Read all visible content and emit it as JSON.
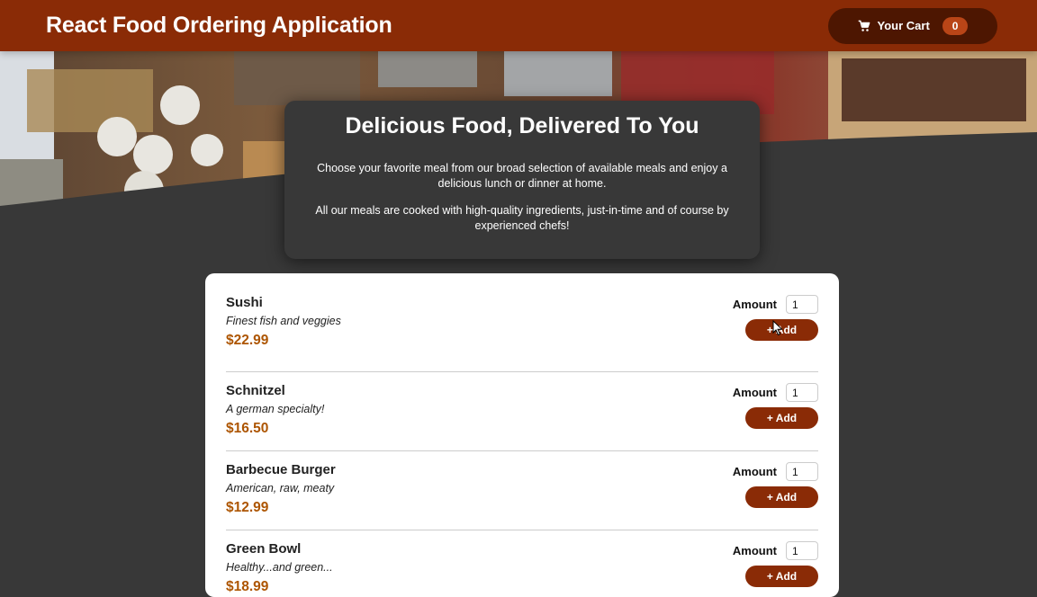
{
  "header": {
    "title": "React Food Ordering Application",
    "cart_label": "Your Cart",
    "cart_count": "0",
    "cart_icon": "cart-icon"
  },
  "summary": {
    "title": "Delicious Food, Delivered To You",
    "paragraph1": "Choose your favorite meal from our broad selection of available meals and enjoy a delicious lunch or dinner at home.",
    "paragraph2": "All our meals are cooked with high-quality ingredients, just-in-time and of course by experienced chefs!"
  },
  "meals": [
    {
      "name": "Sushi",
      "description": "Finest fish and veggies",
      "price": "$22.99",
      "amount_label": "Amount",
      "amount": "1",
      "add_label": "+ Add"
    },
    {
      "name": "Schnitzel",
      "description": "A german specialty!",
      "price": "$16.50",
      "amount_label": "Amount",
      "amount": "1",
      "add_label": "+ Add"
    },
    {
      "name": "Barbecue Burger",
      "description": "American, raw, meaty",
      "price": "$12.99",
      "amount_label": "Amount",
      "amount": "1",
      "add_label": "+ Add"
    },
    {
      "name": "Green Bowl",
      "description": "Healthy...and green...",
      "price": "$18.99",
      "amount_label": "Amount",
      "amount": "1",
      "add_label": "+ Add"
    }
  ],
  "colors": {
    "header": "#8a2b06",
    "cart_button": "#4d1601",
    "badge": "#b94517",
    "price": "#ad5502",
    "background": "#383838"
  }
}
